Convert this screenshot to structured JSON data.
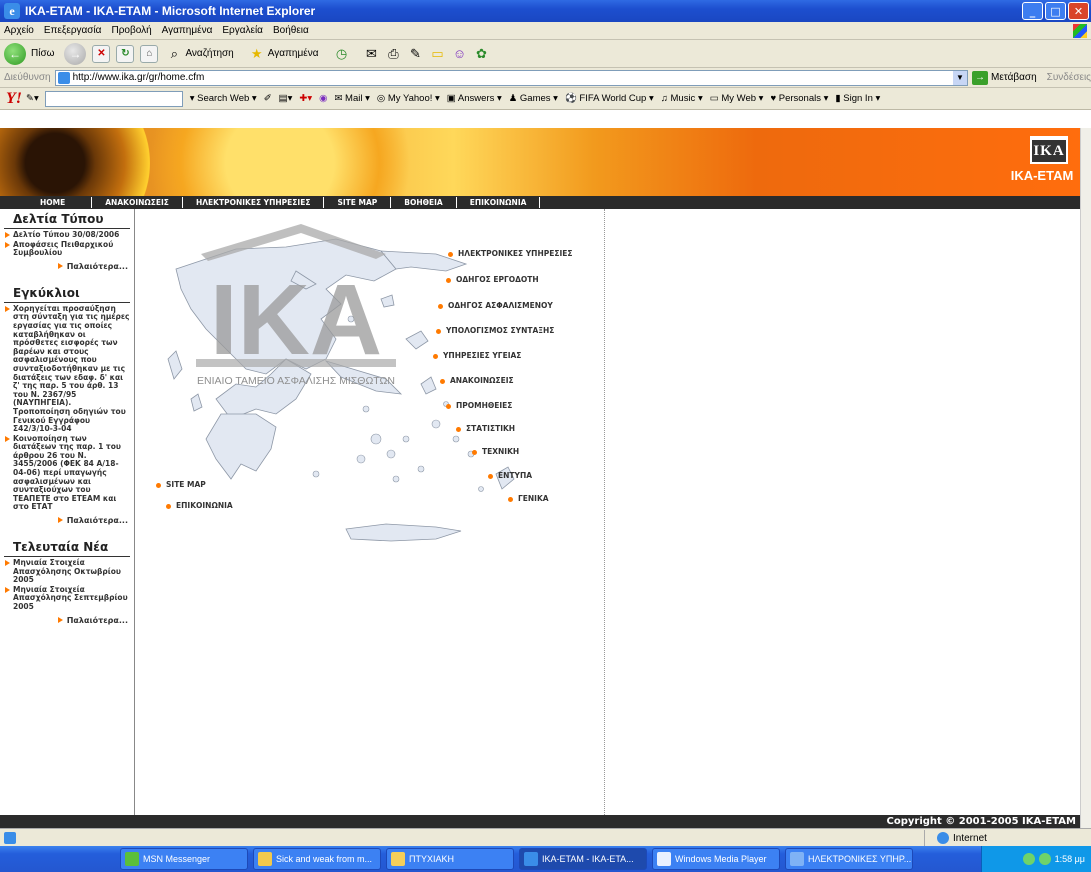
{
  "window": {
    "title": "IKA-ETAM - IKA-ETAM - Microsoft Internet Explorer"
  },
  "menu": [
    "Αρχείο",
    "Επεξεργασία",
    "Προβολή",
    "Αγαπημένα",
    "Εργαλεία",
    "Βοήθεια"
  ],
  "toolbar": {
    "back": "Πίσω",
    "search": "Αναζήτηση",
    "favorites": "Αγαπημένα"
  },
  "address": {
    "label": "Διεύθυνση",
    "url": "http://www.ika.gr/gr/home.cfm",
    "go": "Μετάβαση",
    "links": "Συνδέσεις"
  },
  "yahoo": {
    "logo": "Y!",
    "search_web": "Search Web",
    "items": [
      "Mail",
      "My Yahoo!",
      "Answers",
      "Games",
      "FIFA World Cup",
      "Music",
      "My Web",
      "Personals",
      "Sign In"
    ]
  },
  "site": {
    "brand": "IKA-ETAM",
    "logo_text": "IKA",
    "nav": [
      "HOME",
      "ΑΝΑΚΟΙΝΩΣΕΙΣ",
      "ΗΛΕΚΤΡΟΝΙΚΕΣ ΥΠΗΡΕΣΙΕΣ",
      "SITE MAP",
      "ΒΟΗΘΕΙΑ",
      "ΕΠΙΚΟΙΝΩΝΙΑ"
    ],
    "map_watermark": "IKA",
    "map_caption": "ΕΝΙΑΙΟ ΤΑΜΕΙΟ ΑΣΦΑΛΙΣΗΣ ΜΙΣΘΩΤΩΝ",
    "footer": "Copyright © 2001-2005 IKA-ETAM"
  },
  "sidebar": {
    "press": {
      "title": "Δελτία Τύπου",
      "items": [
        "Δελτίο Τύπου 30/08/2006",
        "Αποφάσεις Πειθαρχικού Συμβουλίου"
      ],
      "older": "Παλαιότερα..."
    },
    "circulars": {
      "title": "Εγκύκλιοι",
      "items": [
        "Χορηγείται προσαύξηση στη σύνταξη για τις ημέρες εργασίας για τις οποίες καταβλήθηκαν οι πρόσθετες εισφορές των βαρέων και στους ασφαλισμένους που συνταξιοδοτήθηκαν με τις διατάξεις των εδαφ. δ' και ζ' της παρ. 5 του άρθ. 13 του Ν. 2367/95 (ΝΑΥΠΗΓΕΙΑ). Τροποποίηση οδηγιών του Γενικού Εγγράφου Σ42/3/10-3-04",
        "Κοινοποίηση των διατάξεων της παρ. 1 του άρθρου 26 του Ν. 3455/2006 (ΦΕΚ 84 Α/18-04-06) περί υπαγωγής ασφαλισμένων και συνταξιούχων του ΤΕΑΠΕΤΕ στο ΕΤΕΑΜ και στο ΕΤΑΤ"
      ],
      "older": "Παλαιότερα..."
    },
    "news": {
      "title": "Τελευταία Νέα",
      "items": [
        "Μηνιαία Στοιχεία Απασχόλησης Οκτωβρίου 2005",
        "Μηνιαία Στοιχεία Απασχόλησης Σεπτεμβρίου 2005"
      ],
      "older": "Παλαιότερα..."
    }
  },
  "map_links": [
    "ΗΛΕΚΤΡΟΝΙΚΕΣ ΥΠΗΡΕΣΙΕΣ",
    "ΟΔΗΓΟΣ ΕΡΓΟΔΟΤΗ",
    "ΟΔΗΓΟΣ ΑΣΦΑΛΙΣΜΕΝΟΥ",
    "ΥΠΟΛΟΓΙΣΜΟΣ ΣΥΝΤΑΞΗΣ",
    "ΥΠΗΡΕΣΙΕΣ ΥΓΕΙΑΣ",
    "ΑΝΑΚΟΙΝΩΣΕΙΣ",
    "ΠΡΟΜΗΘΕΙΕΣ",
    "ΣΤΑΤΙΣΤΙΚΗ",
    "ΤΕΧΝΙΚΗ",
    "ΕΝΤΥΠΑ",
    "ΓΕΝΙΚΑ",
    "SITE MAP",
    "ΕΠΙΚΟΙΝΩΝΙΑ"
  ],
  "status": {
    "zone": "Internet"
  },
  "taskbar": {
    "tasks": [
      "MSN Messenger",
      "Sick and weak from m...",
      "ΠΤΥΧΙΑΚΗ",
      "IKA-ETAM - IKA-ETA...",
      "Windows Media Player",
      "ΗΛΕΚΤΡΟΝΙΚΕΣ ΥΠΗΡ..."
    ],
    "clock": "1:58 μμ"
  }
}
